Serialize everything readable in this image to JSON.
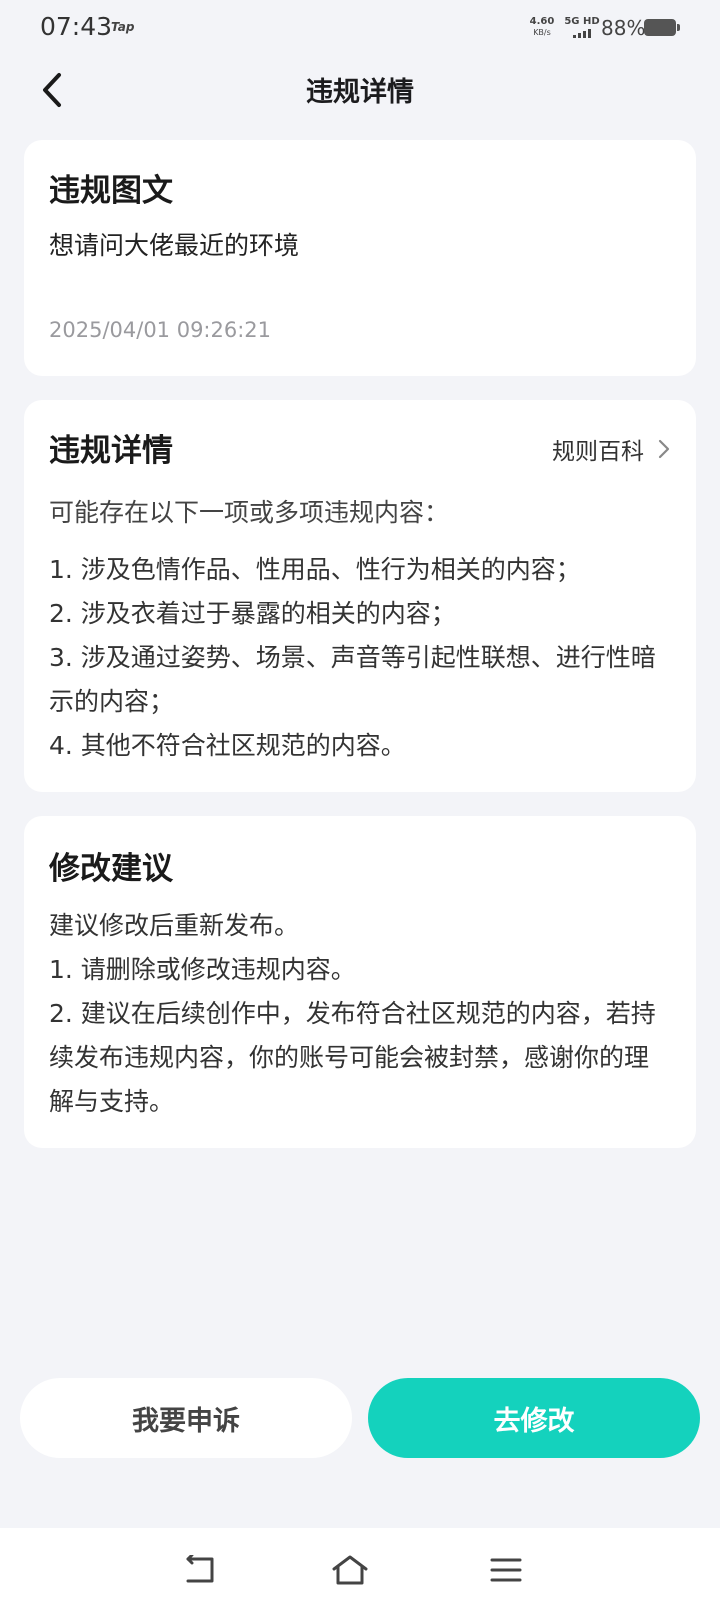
{
  "status": {
    "time": "07:43",
    "tap_label": "Tap",
    "net_speed": "4.60",
    "net_unit": "KB/s",
    "network": "5G HD",
    "battery": "88%"
  },
  "nav": {
    "title": "违规详情"
  },
  "violation_post": {
    "title": "违规图文",
    "body": "想请问大佬最近的环境",
    "timestamp": "2025/04/01 09:26:21"
  },
  "violation_details": {
    "title": "违规详情",
    "rules_link": "规则百科",
    "intro": "可能存在以下一项或多项违规内容：",
    "items": [
      "1. 涉及色情作品、性用品、性行为相关的内容；",
      "2. 涉及衣着过于暴露的相关的内容；",
      "3. 涉及通过姿势、场景、声音等引起性联想、进行性暗示的内容；",
      "4. 其他不符合社区规范的内容。"
    ]
  },
  "suggestion": {
    "title": "修改建议",
    "lines": [
      "建议修改后重新发布。",
      "1. 请删除或修改违规内容。",
      "2. 建议在后续创作中，发布符合社区规范的内容，若持续发布违规内容，你的账号可能会被封禁，感谢你的理解与支持。"
    ]
  },
  "actions": {
    "appeal": "我要申诉",
    "modify": "去修改"
  },
  "colors": {
    "accent": "#14d2bd",
    "background": "#f3f4f8"
  }
}
